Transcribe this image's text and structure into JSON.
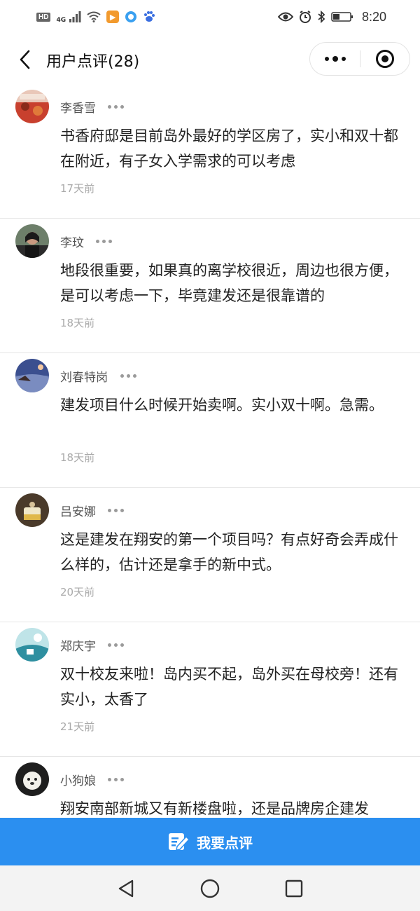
{
  "status_bar": {
    "hd": "HD",
    "network": "4G",
    "time": "8:20",
    "icons": [
      "signal-icon",
      "wifi-icon",
      "video-app-icon",
      "browser-app-icon",
      "baidu-app-icon",
      "eye-icon",
      "alarm-icon",
      "bluetooth-icon",
      "battery-icon"
    ]
  },
  "header": {
    "title": "用户点评(28)",
    "back_icon": "chevron-left-icon",
    "menu_icon": "more-dots-icon",
    "close_icon": "target-icon"
  },
  "reviews": [
    {
      "name": "李香雪",
      "text": "书香府邸是目前岛外最好的学区房了，实小和双十都在附近，有子女入学需求的可以考虑",
      "time": "17天前"
    },
    {
      "name": "李玟",
      "text": "地段很重要，如果真的离学校很近，周边也很方便，是可以考虑一下，毕竟建发还是很靠谱的",
      "time": "18天前"
    },
    {
      "name": "刘春特岗",
      "text": "建发项目什么时候开始卖啊。实小双十啊。急需。",
      "time": "18天前"
    },
    {
      "name": "吕安娜",
      "text": "这是建发在翔安的第一个项目吗？有点好奇会弄成什么样的，估计还是拿手的新中式。",
      "time": "20天前"
    },
    {
      "name": "郑庆宇",
      "text": "双十校友来啦！岛内买不起，岛外买在母校旁！还有实小，太香了",
      "time": "21天前"
    },
    {
      "name": "小狗娘",
      "text": "翔安南部新城又有新楼盘啦，还是品牌房企建发",
      "time": ""
    }
  ],
  "action_bar": {
    "label": "我要点评",
    "icon": "edit-icon"
  },
  "colors": {
    "accent": "#2b8ff0",
    "muted": "#aaaaaa"
  },
  "nav_bar": {
    "icons": [
      "back-triangle-icon",
      "home-circle-icon",
      "recents-square-icon"
    ]
  }
}
